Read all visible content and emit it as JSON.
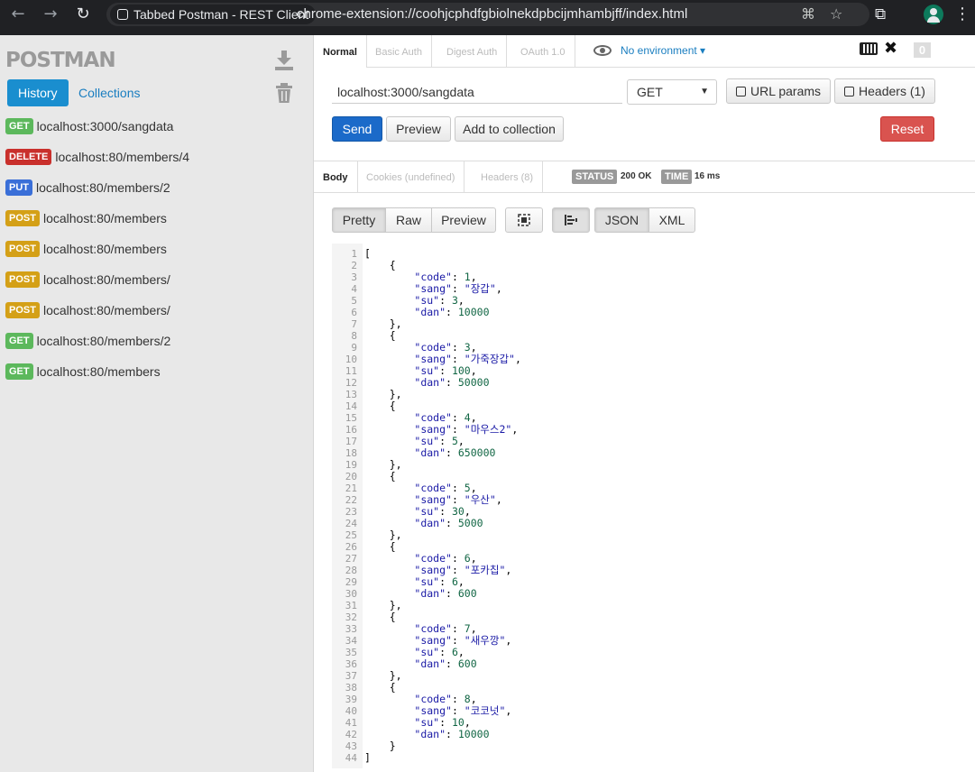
{
  "browser": {
    "tab_title": "Tabbed Postman - REST Client",
    "url": "chrome-extension://coohjcphdfgbiolnekdpbcijmhambjff/index.html"
  },
  "sidebar": {
    "logo": "POSTMAN",
    "tabs": [
      "History",
      "Collections"
    ],
    "history": [
      {
        "method": "GET",
        "url": "localhost:3000/sangdata"
      },
      {
        "method": "DELETE",
        "url": "localhost:80/members/4"
      },
      {
        "method": "PUT",
        "url": "localhost:80/members/2"
      },
      {
        "method": "POST",
        "url": "localhost:80/members"
      },
      {
        "method": "POST",
        "url": "localhost:80/members"
      },
      {
        "method": "POST",
        "url": "localhost:80/members/"
      },
      {
        "method": "POST",
        "url": "localhost:80/members/"
      },
      {
        "method": "GET",
        "url": "localhost:80/members/2"
      },
      {
        "method": "GET",
        "url": "localhost:80/members"
      }
    ]
  },
  "request": {
    "auth_tabs": [
      "Normal",
      "Basic Auth",
      "Digest Auth",
      "OAuth 1.0"
    ],
    "environment": "No environment ▾",
    "badge_count": "0",
    "url_value": "localhost:3000/sangdata",
    "method": "GET",
    "url_params_label": "URL params",
    "headers_label": "Headers (1)",
    "send_label": "Send",
    "preview_label": "Preview",
    "add_collection_label": "Add to collection",
    "reset_label": "Reset"
  },
  "response": {
    "tabs": [
      "Body",
      "Cookies (undefined)",
      "Headers (8)"
    ],
    "status_label": "STATUS",
    "status_value": "200 OK",
    "time_label": "TIME",
    "time_value": "16 ms",
    "view_buttons": [
      "Pretty",
      "Raw",
      "Preview"
    ],
    "format_buttons": [
      "JSON",
      "XML"
    ],
    "body": [
      {
        "code": 1,
        "sang": "장갑",
        "su": 3,
        "dan": 10000
      },
      {
        "code": 3,
        "sang": "가죽장갑",
        "su": 100,
        "dan": 50000
      },
      {
        "code": 4,
        "sang": "마우스2",
        "su": 5,
        "dan": 650000
      },
      {
        "code": 5,
        "sang": "우산",
        "su": 30,
        "dan": 5000
      },
      {
        "code": 6,
        "sang": "포카칩",
        "su": 6,
        "dan": 600
      },
      {
        "code": 7,
        "sang": "새우깡",
        "su": 6,
        "dan": 600
      },
      {
        "code": 8,
        "sang": "코코넛",
        "su": 10,
        "dan": 10000
      }
    ]
  }
}
